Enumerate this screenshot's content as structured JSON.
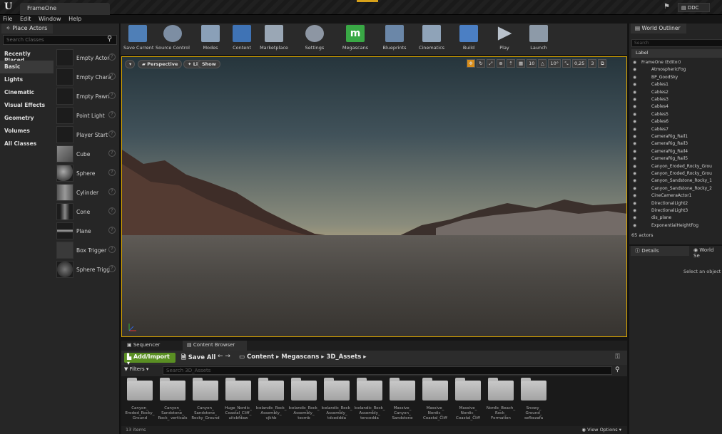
{
  "titlebar": {
    "doc_tab": "FrameOne",
    "ddc_label": "DDC"
  },
  "menu": [
    "File",
    "Edit",
    "Window",
    "Help"
  ],
  "place_actors": {
    "tab": "Place Actors",
    "search_placeholder": "Search Classes",
    "categories": [
      "Recently Placed",
      "Basic",
      "Lights",
      "Cinematic",
      "Visual Effects",
      "Geometry",
      "Volumes",
      "All Classes"
    ],
    "actors": [
      "Empty Actor",
      "Empty Chara",
      "Empty Pawn",
      "Point Light",
      "Player Start",
      "Cube",
      "Sphere",
      "Cylinder",
      "Cone",
      "Plane",
      "Box Trigger",
      "Sphere Trigg"
    ]
  },
  "toolbar": {
    "items": [
      "Save Current",
      "Source Control",
      "Modes",
      "Content",
      "Marketplace",
      "Settings",
      "Megascans",
      "Blueprints",
      "Cinematics",
      "Build",
      "Play",
      "Launch"
    ],
    "colors": [
      "#4f7fb7",
      "#7d8ea3",
      "#8aa0b8",
      "#3f73b5",
      "#9aa7b5",
      "#8d96a3",
      "#39a845",
      "#6b87a8",
      "#8fa3b8",
      "#4b7fc4",
      "#b9c2cc",
      "#8d9aa8"
    ]
  },
  "viewport": {
    "perspective": "Perspective",
    "lit": "Lit",
    "show": "Show",
    "grid_snap": "10",
    "rot_snap": "10°",
    "scale_snap": "0,25",
    "cam_speed": "3"
  },
  "bottom": {
    "tabs": [
      "Sequencer",
      "Content Browser"
    ],
    "add_import": "Add/Import",
    "save_all": "Save All",
    "crumbs": [
      "Content",
      "Megascans",
      "3D_Assets"
    ],
    "filters": "Filters",
    "search_placeholder": "Search 3D_Assets",
    "assets": [
      "Canyon_ Eroded_Rocky_ Ground",
      "Canyon_ Sandstone_ Rock_ verticals",
      "Canyon_ Sandstone_ Rocky_Ground",
      "Huge_Nordic_ Coastal_Cliff_ uitcbfdaw",
      "Icelandic_Rock_ Assembly_ vjkhb",
      "Icelandic_Rock_ Assembly_ tecmb",
      "Icelandic_Rock_ Assembly_ tdceddda",
      "Icelandic_Rock_ Assembly_ tencedda",
      "Massive_ Canyon_ Sandstone",
      "Massive_ Nordic_ Coastal_Cliff",
      "Massive_ Nordic_ Coastal_Cliff",
      "Nordic_Beach_ Rock_ Formation",
      "Snowy_ Ground_ sefkezafa"
    ],
    "items_count": "13 items",
    "view_options": "View Options"
  },
  "outliner": {
    "tab": "World Outliner",
    "search_placeholder": "Search",
    "label_header": "Label",
    "rows": [
      "FrameOne (Editor)",
      "AtmosphericFog",
      "BP_GoodSky",
      "Cables1",
      "Cables2",
      "Cables3",
      "Cables4",
      "Cables5",
      "Cables6",
      "Cables7",
      "CameraRig_Rail1",
      "CameraRig_Rail3",
      "CameraRig_Rail4",
      "CameraRig_Rail5",
      "Canyon_Eroded_Rocky_Grou",
      "Canyon_Eroded_Rocky_Grou",
      "Canyon_Sandstone_Rocky_1",
      "Canyon_Sandstone_Rocky_2",
      "CineCameraActor1",
      "DirectionalLight2",
      "DirectionalLight3",
      "dis_plane",
      "ExponentialHeightFog"
    ],
    "count": "65 actors"
  },
  "details": {
    "tab": "Details",
    "tab2": "World Se",
    "message": "Select an object to"
  }
}
